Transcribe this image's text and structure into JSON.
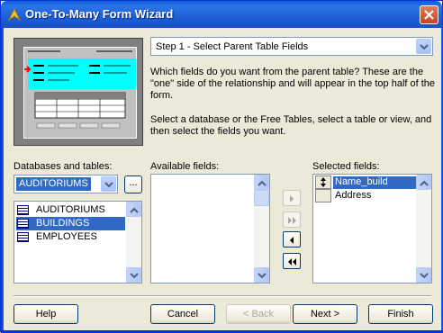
{
  "window": {
    "title": "One-To-Many Form Wizard"
  },
  "step": {
    "selected": "Step 1 - Select Parent Table Fields"
  },
  "description": {
    "para1": "Which fields do you want from the parent table? These are the \"one\" side of the relationship and will appear in the top half of the form.",
    "para2": "Select a database or the Free Tables, select a table or view, and then select the fields you want."
  },
  "databases": {
    "label": "Databases and tables:",
    "selected": "AUDITORIUMS",
    "browse_label": "...",
    "tables": [
      "AUDITORIUMS",
      "BUILDINGS",
      "EMPLOYEES"
    ],
    "selected_table": "BUILDINGS"
  },
  "available": {
    "label": "Available fields:",
    "items": []
  },
  "selected_fields": {
    "label": "Selected fields:",
    "items": [
      "Name_build",
      "Address"
    ],
    "selected_item": "Name_build"
  },
  "buttons": {
    "help": "Help",
    "cancel": "Cancel",
    "back": "< Back",
    "next": "Next >",
    "finish": "Finish"
  },
  "colors": {
    "accent": "#316ac5",
    "titlebar": "#0a5fd8",
    "preview_highlight": "#00ffff"
  }
}
